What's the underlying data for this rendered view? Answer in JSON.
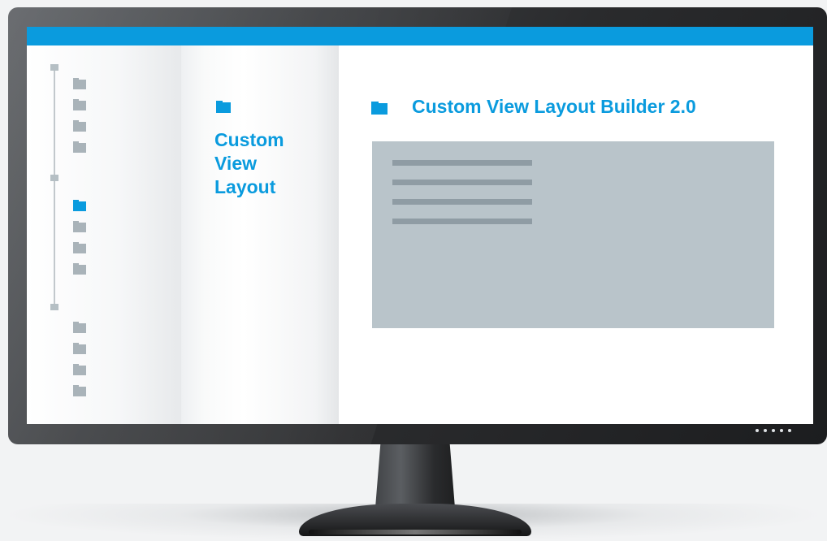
{
  "colors": {
    "accent": "#0a9bde",
    "folder": "#a9b3b9",
    "panel": "#b9c4ca",
    "line": "#8f9ca4"
  },
  "sidebar": {
    "groups": [
      {
        "node_icon": "tree-node-icon",
        "items": [
          {
            "icon": "folder-icon",
            "active": false
          },
          {
            "icon": "folder-icon",
            "active": false
          },
          {
            "icon": "folder-icon",
            "active": false
          },
          {
            "icon": "folder-icon",
            "active": false
          }
        ]
      },
      {
        "node_icon": "tree-node-icon",
        "items": [
          {
            "icon": "folder-icon",
            "active": true
          },
          {
            "icon": "folder-icon",
            "active": false
          },
          {
            "icon": "folder-icon",
            "active": false
          },
          {
            "icon": "folder-icon",
            "active": false
          }
        ]
      },
      {
        "node_icon": "tree-node-icon",
        "items": [
          {
            "icon": "folder-icon",
            "active": false
          },
          {
            "icon": "folder-icon",
            "active": false
          },
          {
            "icon": "folder-icon",
            "active": false
          },
          {
            "icon": "folder-icon",
            "active": false
          }
        ]
      }
    ]
  },
  "middle": {
    "icon": "folder-icon",
    "title_lines": [
      "Custom",
      "View",
      "Layout"
    ]
  },
  "main": {
    "icon": "folder-icon",
    "title": "Custom View Layout Builder 2.0"
  },
  "monitor": {
    "indicator_dots": 5
  }
}
